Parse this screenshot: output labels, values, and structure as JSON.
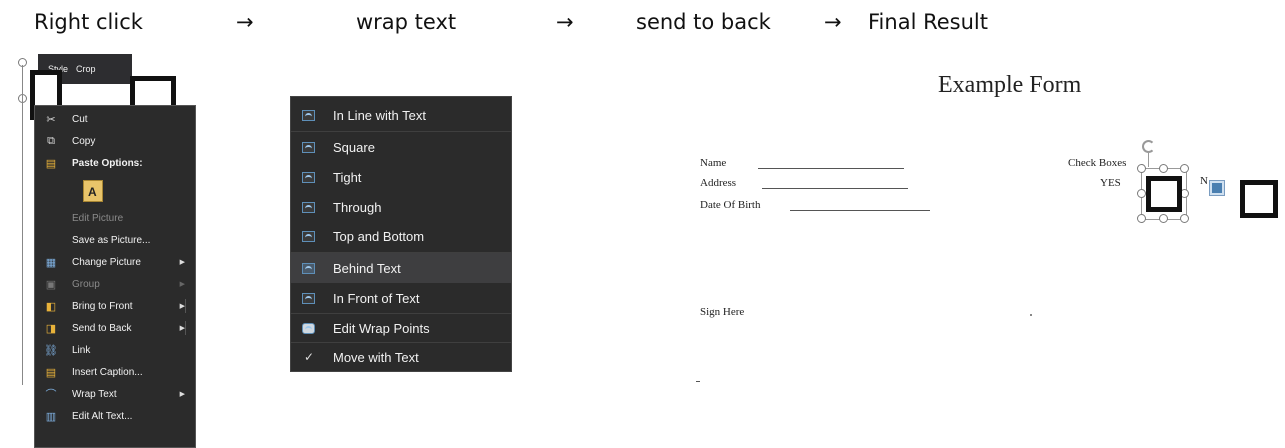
{
  "steps": {
    "step1": "Right click",
    "step2": "wrap text",
    "step3": "send to back",
    "step4": "Final Result",
    "arrow": "→"
  },
  "mini_toolbar": {
    "style": "Style",
    "crop": "Crop"
  },
  "context_menu": {
    "items": [
      {
        "label": "Cut",
        "icon": "scissors-icon",
        "glyph": "✂"
      },
      {
        "label": "Copy",
        "icon": "copy-icon",
        "glyph": "⧉"
      },
      {
        "label": "Paste Options:",
        "icon": "paste-icon",
        "glyph": "📋"
      },
      {
        "label": "Edit Picture",
        "icon": "",
        "glyph": ""
      },
      {
        "label": "Save as Picture...",
        "icon": "",
        "glyph": ""
      },
      {
        "label": "Change Picture",
        "icon": "change-picture-icon",
        "glyph": "▦"
      },
      {
        "label": "Group",
        "icon": "group-icon",
        "glyph": "▣"
      },
      {
        "label": "Bring to Front",
        "icon": "bring-front-icon",
        "glyph": "◧"
      },
      {
        "label": "Send to Back",
        "icon": "send-back-icon",
        "glyph": "◨"
      },
      {
        "label": "Link",
        "icon": "link-icon",
        "glyph": "⛓"
      },
      {
        "label": "Insert Caption...",
        "icon": "caption-icon",
        "glyph": "▤"
      },
      {
        "label": "Wrap Text",
        "icon": "wrap-text-icon",
        "glyph": "⌒"
      },
      {
        "label": "Edit Alt Text...",
        "icon": "alt-text-icon",
        "glyph": "▥"
      }
    ]
  },
  "wrap_menu": {
    "items": [
      {
        "label": "In Line with Text"
      },
      {
        "label": "Square"
      },
      {
        "label": "Tight"
      },
      {
        "label": "Through"
      },
      {
        "label": "Top and Bottom"
      },
      {
        "label": "Behind Text"
      },
      {
        "label": "In Front of Text"
      },
      {
        "label": "Edit Wrap Points"
      },
      {
        "label": "Move with Text"
      }
    ],
    "check": "✓"
  },
  "document": {
    "title": "Example Form",
    "name": "Name",
    "address": "Address",
    "dob": "Date Of Birth",
    "check_boxes": "Check Boxes",
    "yes": "YES",
    "no": "N",
    "sign": "Sign Here"
  },
  "colors": {
    "menu_bg": "#2b2b2b",
    "menu_text": "#f2f2f2",
    "accent": "#5e8fb8"
  }
}
